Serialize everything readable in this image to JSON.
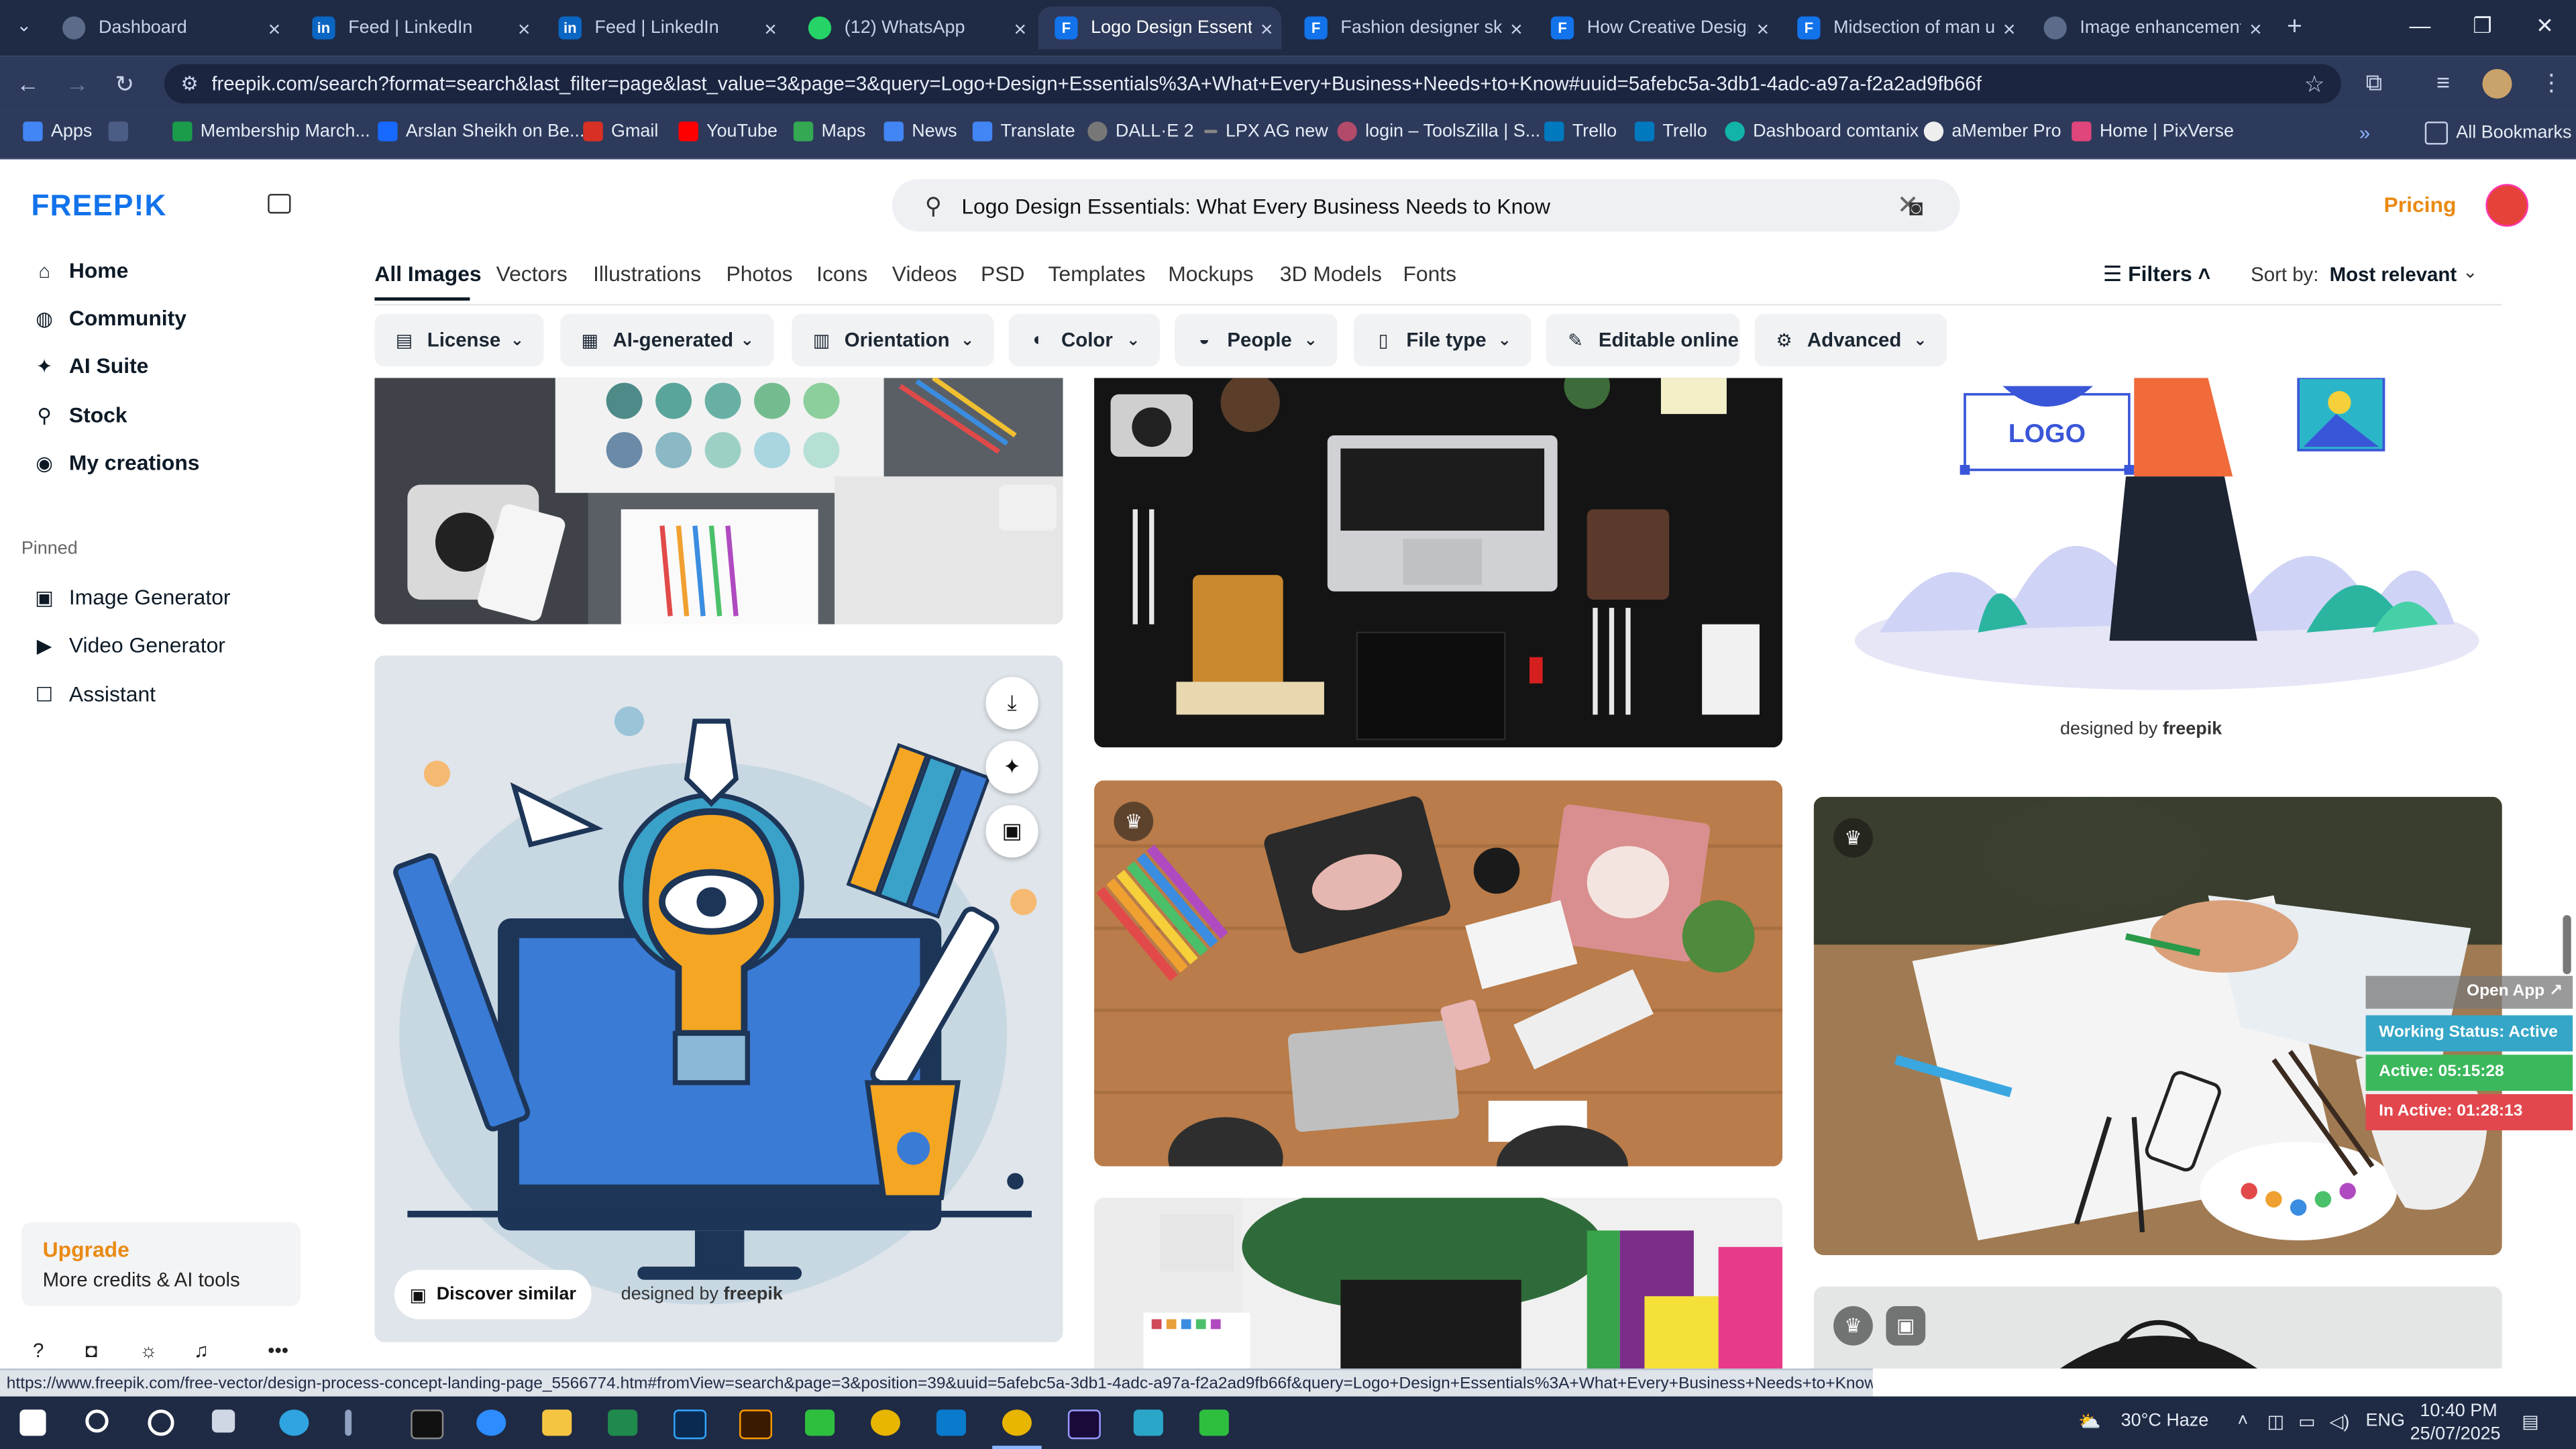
{
  "tabs": [
    {
      "title": "Dashboard",
      "icon": "dashboard-icon"
    },
    {
      "title": "Feed | LinkedIn",
      "icon": "linkedin-icon"
    },
    {
      "title": "Feed | LinkedIn",
      "icon": "linkedin-icon"
    },
    {
      "title": "(12) WhatsApp",
      "icon": "whatsapp-icon"
    },
    {
      "title": "Logo Design Essenti",
      "icon": "freepik-icon"
    },
    {
      "title": "Fashion designer ske",
      "icon": "freepik-icon"
    },
    {
      "title": "How Creative Design",
      "icon": "freepik-icon"
    },
    {
      "title": "Midsection of man u",
      "icon": "freepik-icon"
    },
    {
      "title": "Image enhancement",
      "icon": "tab-icon"
    }
  ],
  "address_bar": {
    "url": "freepik.com/search?format=search&last_filter=page&last_value=3&page=3&query=Logo+Design+Essentials%3A+What+Every+Business+Needs+to+Know#uuid=5afebc5a-3db1-4adc-a97a-f2a2ad9fb66f"
  },
  "bookmarks": [
    {
      "label": "Apps",
      "color": "#4285f4"
    },
    {
      "label": "Membership March...",
      "color": "#1a9c4a"
    },
    {
      "label": "Arslan Sheikh on Be...",
      "color": "#1769ff"
    },
    {
      "label": "Gmail",
      "color": "#d93025"
    },
    {
      "label": "YouTube",
      "color": "#ff0000"
    },
    {
      "label": "Maps",
      "color": "#34a853"
    },
    {
      "label": "News",
      "color": "#4285f4"
    },
    {
      "label": "Translate",
      "color": "#4285f4"
    },
    {
      "label": "DALL·E 2",
      "color": "#777777"
    },
    {
      "label": "LPX AG new",
      "color": "#888888"
    },
    {
      "label": "login – ToolsZilla | S...",
      "color": "#b24a6a"
    },
    {
      "label": "Trello",
      "color": "#0079bf"
    },
    {
      "label": "Trello",
      "color": "#0079bf"
    },
    {
      "label": "Dashboard comtanix",
      "color": "#12b3a8"
    },
    {
      "label": "aMember Pro",
      "color": "#333333"
    },
    {
      "label": "Home | PixVerse",
      "color": "#e0457b"
    }
  ],
  "all_bookmarks": "All Bookmarks",
  "sidebar": {
    "logo": "FREEP!K",
    "nav": [
      {
        "label": "Home",
        "icon": "home-icon",
        "glyph": "⌂"
      },
      {
        "label": "Community",
        "icon": "globe-icon",
        "glyph": "◍"
      },
      {
        "label": "AI Suite",
        "icon": "sparkle-icon",
        "glyph": "✦"
      },
      {
        "label": "Stock",
        "icon": "search-icon",
        "glyph": "⚲"
      },
      {
        "label": "My creations",
        "icon": "user-icon",
        "glyph": "◉"
      }
    ],
    "pinned_label": "Pinned",
    "pinned": [
      {
        "label": "Image Generator",
        "icon": "image-icon",
        "glyph": "▣"
      },
      {
        "label": "Video Generator",
        "icon": "video-icon",
        "glyph": "▶"
      },
      {
        "label": "Assistant",
        "icon": "chat-icon",
        "glyph": "☐"
      }
    ],
    "upgrade_title": "Upgrade",
    "upgrade_subtitle": "More credits & AI tools"
  },
  "search": {
    "query": "Logo Design Essentials: What Every Business Needs to Know"
  },
  "pricing": "Pricing",
  "content_tabs": [
    "All Images",
    "Vectors",
    "Illustrations",
    "Photos",
    "Icons",
    "Videos",
    "PSD",
    "Templates",
    "Mockups",
    "3D Models",
    "Fonts"
  ],
  "filters_label": "Filters",
  "sort": {
    "label": "Sort by:",
    "value": "Most relevant"
  },
  "filter_chips": [
    {
      "label": "License",
      "icon": "license-icon",
      "dropdown": true
    },
    {
      "label": "AI-generated",
      "icon": "ai-icon",
      "dropdown": true
    },
    {
      "label": "Orientation",
      "icon": "orientation-icon",
      "dropdown": true
    },
    {
      "label": "Color",
      "icon": "palette-icon",
      "dropdown": true
    },
    {
      "label": "People",
      "icon": "people-icon",
      "dropdown": true
    },
    {
      "label": "File type",
      "icon": "file-icon",
      "dropdown": true
    },
    {
      "label": "Editable online",
      "icon": "pen-icon",
      "dropdown": false
    },
    {
      "label": "Advanced",
      "icon": "gear-icon",
      "dropdown": true
    }
  ],
  "results": {
    "logo_text": "LOGO",
    "discover_similar": "Discover similar",
    "credit_prefix": "designed by",
    "credit_brand": "freepik"
  },
  "tracker_widget": {
    "open_app": "Open App ↗",
    "working_status": "Working Status: Active",
    "active": "Active: 05:15:28",
    "inactive": "In Active: 01:28:13"
  },
  "status_url": "https://www.freepik.com/free-vector/design-process-concept-landing-page_5566774.htm#fromView=search&page=3&position=39&uuid=5afebc5a-3db1-4adc-a97a-f2a2ad9fb66f&query=Logo+Design+Essentials%3A+What+Every+Business+Needs+to+Know",
  "taskbar": {
    "weather": "30°C  Haze",
    "lang": "ENG",
    "time": "10:40 PM",
    "date": "25/07/2025"
  }
}
